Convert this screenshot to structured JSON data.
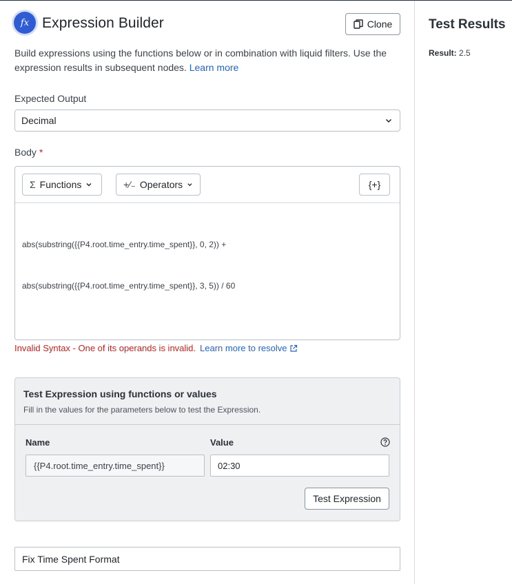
{
  "builder": {
    "logo_glyph": "fx",
    "title": "Expression Builder",
    "clone_label": "Clone",
    "description": "Build expressions using the functions below or in combination with liquid filters. Use the expression results in subsequent nodes.",
    "learn_more": "Learn more"
  },
  "expected_output": {
    "label": "Expected Output",
    "value": "Decimal"
  },
  "body": {
    "label": "Body",
    "required_marker": "*",
    "functions_symbol": "Σ",
    "functions_label": "Functions",
    "operators_symbol": "+∕₋",
    "operators_label": "Operators",
    "variables_label": "{+}",
    "code_lines": [
      "abs(substring({{P4.root.time_entry.time_spent}}, 0, 2)) +",
      "abs(substring({{P4.root.time_entry.time_spent}}, 3, 5)) / 60"
    ]
  },
  "validation": {
    "error": "Invalid Syntax - One of its operands is invalid.",
    "resolve_link": "Learn more to resolve",
    "color": "#c5221f"
  },
  "test": {
    "title": "Test Expression using functions or values",
    "subtitle": "Fill in the values for the parameters below to test the Expression.",
    "name_header": "Name",
    "value_header": "Value",
    "param_name": "{{P4.root.time_entry.time_spent}}",
    "param_value": "02:30",
    "button_label": "Test Expression"
  },
  "node_name": {
    "value": "Fix Time Spent Format"
  },
  "results": {
    "title": "Test Results",
    "result_label": "Result:",
    "result_value": "2.5"
  },
  "colors": {
    "accent": "#2463c7",
    "logo": "#2f5bd3"
  }
}
